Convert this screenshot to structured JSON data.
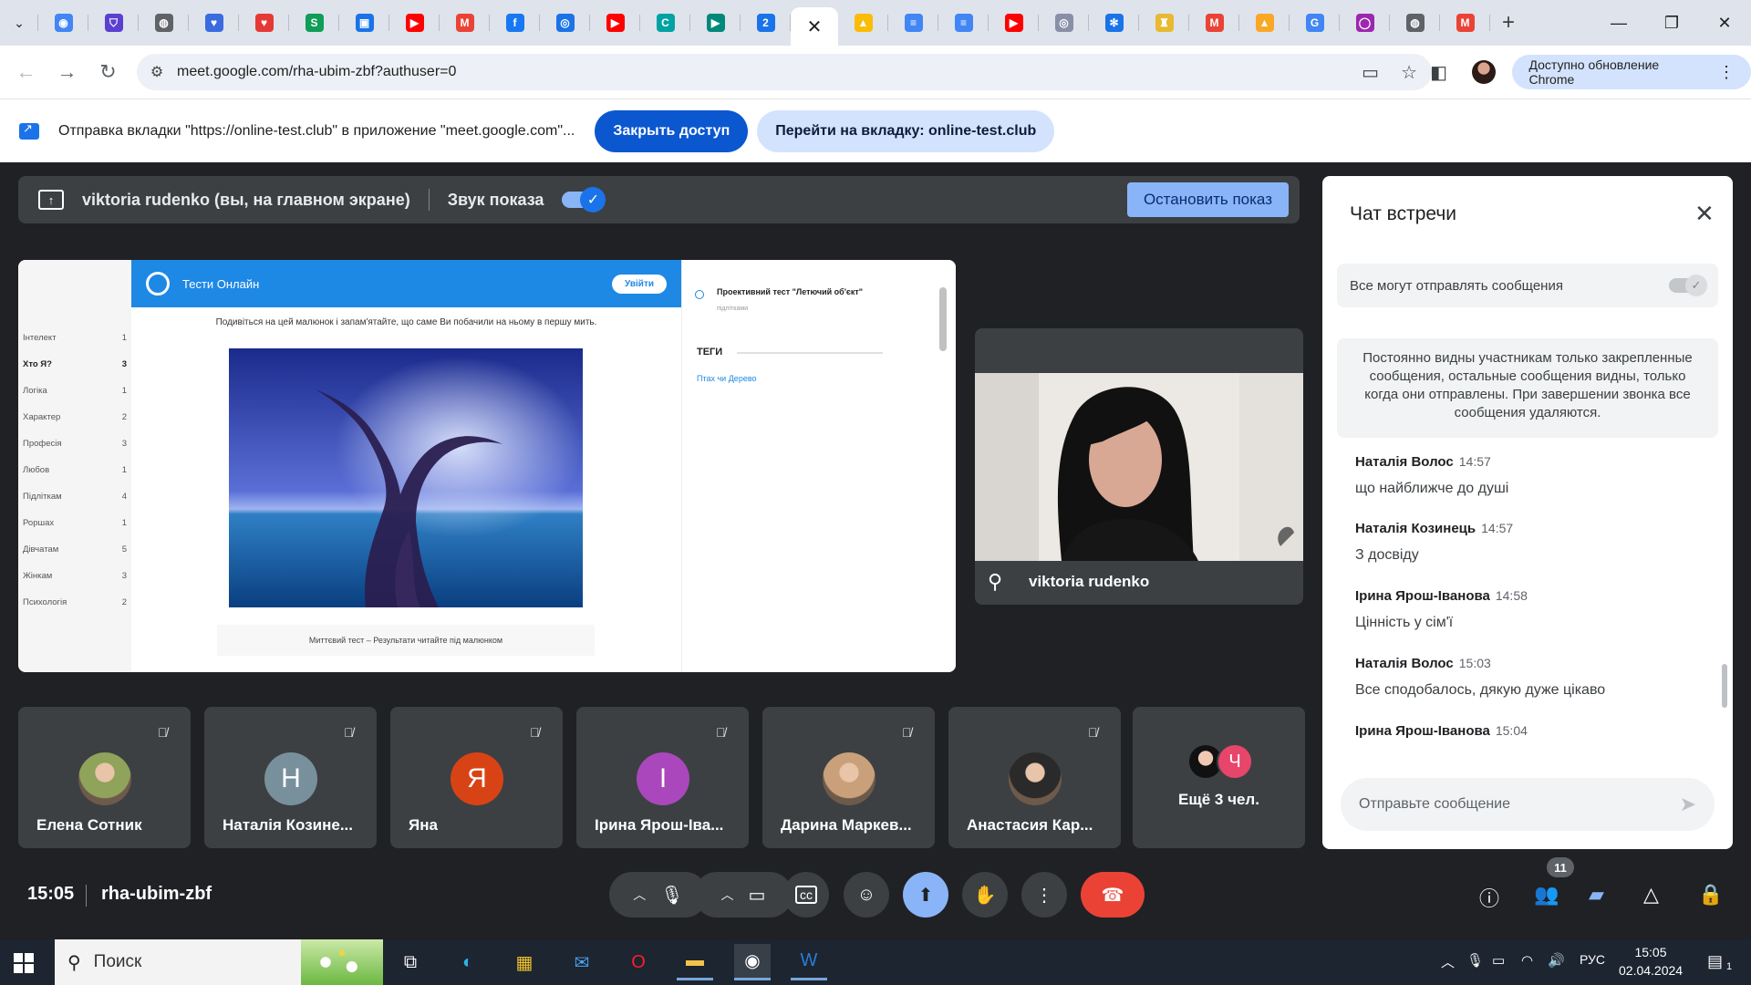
{
  "browser": {
    "tabs": [
      {
        "icon": "chrome-icon",
        "color": "#4285f4",
        "glyph": "◉"
      },
      {
        "icon": "shield-extension-icon",
        "color": "#5b3fd1",
        "glyph": "⛉"
      },
      {
        "icon": "globe-icon",
        "color": "#5f6368",
        "glyph": "◍"
      },
      {
        "icon": "heart-icon",
        "color": "#3b6be0",
        "glyph": "♥"
      },
      {
        "icon": "heart-red-icon",
        "color": "#e53935",
        "glyph": "♥"
      },
      {
        "icon": "sheets-icon",
        "color": "#0f9d58",
        "glyph": "S"
      },
      {
        "icon": "classroom-icon",
        "color": "#1a73e8",
        "glyph": "▣"
      },
      {
        "icon": "youtube-icon",
        "color": "#ff0000",
        "glyph": "▶"
      },
      {
        "icon": "gmail-icon",
        "color": "#ea4335",
        "glyph": "M"
      },
      {
        "icon": "facebook-icon",
        "color": "#1877f2",
        "glyph": "f"
      },
      {
        "icon": "target-icon",
        "color": "#1a73e8",
        "glyph": "◎"
      },
      {
        "icon": "youtube-icon",
        "color": "#ff0000",
        "glyph": "▶"
      },
      {
        "icon": "c-app-icon",
        "color": "#00a3a3",
        "glyph": "C"
      },
      {
        "icon": "meet-icon",
        "color": "#00897b",
        "glyph": "▶"
      },
      {
        "icon": "calendar-icon",
        "color": "#1a73e8",
        "glyph": "2"
      }
    ],
    "active_tab_close": "✕",
    "tabs_after": [
      {
        "icon": "drive-icon",
        "color": "#fbbc04",
        "glyph": "▲"
      },
      {
        "icon": "docs-icon",
        "color": "#4285f4",
        "glyph": "≡"
      },
      {
        "icon": "docs-icon",
        "color": "#4285f4",
        "glyph": "≡"
      },
      {
        "icon": "youtube-icon",
        "color": "#ff0000",
        "glyph": "▶"
      },
      {
        "icon": "globe-icon",
        "color": "#8a8fa8",
        "glyph": "◎"
      },
      {
        "icon": "snowflake-icon",
        "color": "#1a73e8",
        "glyph": "✻"
      },
      {
        "icon": "badge-icon",
        "color": "#e8b931",
        "glyph": "♜"
      },
      {
        "icon": "gmail-icon",
        "color": "#ea4335",
        "glyph": "M"
      },
      {
        "icon": "bell-icon",
        "color": "#f9a825",
        "glyph": "▲"
      },
      {
        "icon": "google-icon",
        "color": "#4285f4",
        "glyph": "G"
      },
      {
        "icon": "chat-bubble-icon",
        "color": "#9c27b0",
        "glyph": "◯"
      },
      {
        "icon": "globe-icon",
        "color": "#5f6368",
        "glyph": "◍"
      },
      {
        "icon": "gmail-icon",
        "color": "#ea4335",
        "glyph": "M"
      }
    ],
    "new_tab": "+",
    "url": "meet.google.com/rha-ubim-zbf?authuser=0",
    "update_label": "Доступно обновление Chrome"
  },
  "infobar": {
    "message": "Отправка вкладки \"https://online-test.club\" в приложение \"meet.google.com\"...",
    "stop_sharing": "Закрыть доступ",
    "goto_tab": "Перейти на вкладку: online-test.club"
  },
  "presenting": {
    "presenter": "viktoria rudenko (вы, на главном экране)",
    "audio_label": "Звук показа",
    "audio_on": true,
    "stop_button": "Остановить показ"
  },
  "shared_screen": {
    "site_title": "Тести Онлайн",
    "login": "Увійти",
    "categories": [
      {
        "name": "Інтелект",
        "count": "1",
        "bold": false
      },
      {
        "name": "Хто Я?",
        "count": "3",
        "bold": true
      },
      {
        "name": "Логіка",
        "count": "1",
        "bold": false
      },
      {
        "name": "Характер",
        "count": "2",
        "bold": false
      },
      {
        "name": "Професія",
        "count": "3",
        "bold": false
      },
      {
        "name": "Любов",
        "count": "1",
        "bold": false
      },
      {
        "name": "Підліткам",
        "count": "4",
        "bold": false
      },
      {
        "name": "Роршах",
        "count": "1",
        "bold": false
      },
      {
        "name": "Дівчатам",
        "count": "5",
        "bold": false
      },
      {
        "name": "Жінкам",
        "count": "3",
        "bold": false
      },
      {
        "name": "Психологія",
        "count": "2",
        "bold": false
      }
    ],
    "instruction": "Подивіться на цей малюнок і запам'ятайте, що саме Ви побачили на ньому в першу мить.",
    "caption": "Миттєвий тест – Результати читайте під малюнком",
    "related_title": "Проективний тест \"Летючий об'єкт\"",
    "related_sub": "підлітками",
    "tags_label": "ТЕГИ",
    "tag": "Птах чи Дерево"
  },
  "presenter_tile": {
    "name": "viktoria rudenko"
  },
  "chat": {
    "title": "Чат встречи",
    "permission_label": "Все могут отправлять сообщения",
    "notice": "Постоянно видны участникам только закрепленные сообщения, остальные сообщения видны, только когда они отправлены. При завершении звонка все сообщения удаляются.",
    "messages": [
      {
        "sender": "Наталія Волос",
        "time": "14:57",
        "text": "що найближче до душі"
      },
      {
        "sender": "Наталія Козинець",
        "time": "14:57",
        "text": "З досвіду"
      },
      {
        "sender": "Ірина Ярош-Іванова",
        "time": "14:58",
        "text": "Цінність у сім'ї"
      },
      {
        "sender": "Наталія Волос",
        "time": "15:03",
        "text": "Все сподобалось, дякую дуже цікаво"
      },
      {
        "sender": "Ірина Ярош-Іванова",
        "time": "15:04",
        "text": ""
      }
    ],
    "input_placeholder": "Отправьте сообщение"
  },
  "participants": [
    {
      "name": "Елена Сотник",
      "initial": "",
      "color": "#8fa35a",
      "photo": true
    },
    {
      "name": "Наталія Козине...",
      "initial": "Н",
      "color": "#78909c",
      "photo": false
    },
    {
      "name": "Яна",
      "initial": "Я",
      "color": "#d84315",
      "photo": false
    },
    {
      "name": "Ірина Ярош-Іва...",
      "initial": "І",
      "color": "#ab47bc",
      "photo": false
    },
    {
      "name": "Дарина Маркев...",
      "initial": "",
      "color": "#c9a07a",
      "photo": true
    },
    {
      "name": "Анастасия Кар...",
      "initial": "",
      "color": "#2a2a2a",
      "photo": true
    }
  ],
  "more_participants": {
    "label": "Ещё 3 чел.",
    "initial": "Ч"
  },
  "meeting": {
    "time": "15:05",
    "code": "rha-ubim-zbf",
    "participant_count": "11"
  },
  "taskbar": {
    "search_placeholder": "Поиск",
    "language": "РУС",
    "clock_time": "15:05",
    "clock_date": "02.04.2024",
    "notification_count": "1"
  },
  "colors": {
    "meet_bg": "#202124",
    "tile_bg": "#3c4043",
    "accent": "#8ab4f8",
    "end_call": "#ea4335"
  }
}
